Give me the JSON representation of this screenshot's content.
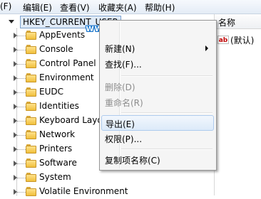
{
  "menubar": {
    "items": [
      {
        "label": "(F)"
      },
      {
        "label": "编辑(E)"
      },
      {
        "label": "查看(V)"
      },
      {
        "label": "收藏夹(A)"
      },
      {
        "label": "帮助(H)"
      }
    ]
  },
  "tree": {
    "root_label": "HKEY_CURRENT_USER",
    "items": [
      {
        "label": "AppEvents"
      },
      {
        "label": "Console"
      },
      {
        "label": "Control Panel"
      },
      {
        "label": "Environment"
      },
      {
        "label": "EUDC"
      },
      {
        "label": "Identities"
      },
      {
        "label": "Keyboard Layo"
      },
      {
        "label": "Network"
      },
      {
        "label": "Printers"
      },
      {
        "label": "Software"
      },
      {
        "label": "System"
      },
      {
        "label": "Volatile Environment"
      }
    ]
  },
  "right_pane": {
    "column_header": "名称",
    "value_name": "(默认)",
    "value_icon": "ab-string-icon"
  },
  "watermark": "www.rjzxw.com",
  "context_menu": {
    "items": [
      {
        "label": "新建(N)",
        "has_submenu": true,
        "disabled": false
      },
      {
        "label": "查找(F)...",
        "disabled": false
      },
      {
        "label": "删除(D)",
        "disabled": true
      },
      {
        "label": "重命名(R)",
        "disabled": true
      },
      {
        "label": "导出(E)",
        "disabled": false,
        "highlighted": true
      },
      {
        "label": "权限(P)...",
        "disabled": false
      },
      {
        "label": "复制项名称(C)",
        "disabled": false
      }
    ]
  },
  "colors": {
    "highlight_border": "#aecbee",
    "selection_bg": "#dfeaf7",
    "watermark_blue": "#1b74c9",
    "folder_yellow": "#f0bf3c"
  }
}
